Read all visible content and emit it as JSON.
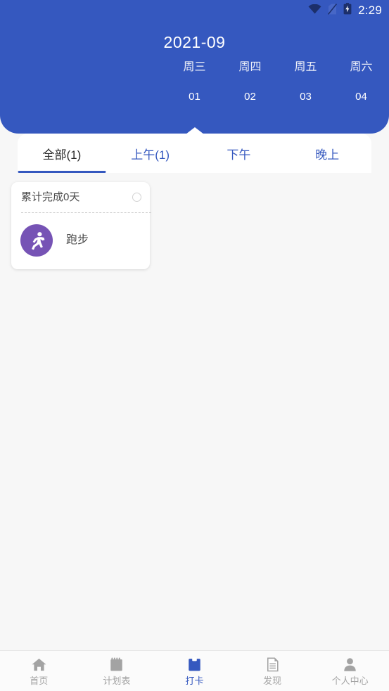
{
  "statusbar": {
    "time": "2:29",
    "icons": [
      "wifi-icon",
      "sim-card-off-icon",
      "battery-charging-icon"
    ]
  },
  "header": {
    "month_title": "2021-09",
    "background_color": "#3558bf",
    "days": [
      {
        "name": "周三",
        "num": "01"
      },
      {
        "name": "周四",
        "num": "02"
      },
      {
        "name": "周五",
        "num": "03"
      },
      {
        "name": "周六",
        "num": "04"
      }
    ]
  },
  "tabs": {
    "items": [
      {
        "label": "全部(1)",
        "active": true
      },
      {
        "label": "上午(1)",
        "active": false
      },
      {
        "label": "下午",
        "active": false
      },
      {
        "label": "晚上",
        "active": false
      }
    ],
    "accent_color": "#3558bf"
  },
  "content": {
    "cards": [
      {
        "title": "累计完成0天",
        "checked": false,
        "icon": "running-person-icon",
        "icon_color": "#7653b5",
        "label": "跑步"
      }
    ]
  },
  "bottom_nav": {
    "items": [
      {
        "label": "首页",
        "icon": "home-icon",
        "active": false
      },
      {
        "label": "计划表",
        "icon": "calendar-icon",
        "active": false
      },
      {
        "label": "打卡",
        "icon": "clipboard-icon",
        "active": true
      },
      {
        "label": "发现",
        "icon": "document-icon",
        "active": false
      },
      {
        "label": "个人中心",
        "icon": "person-icon",
        "active": false
      }
    ],
    "active_color": "#3558bf",
    "inactive_color": "#a3a3a3"
  }
}
